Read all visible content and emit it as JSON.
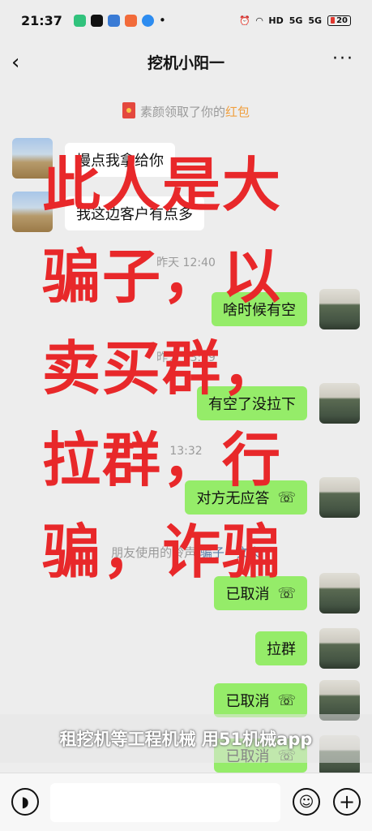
{
  "status_bar": {
    "time": "21:37",
    "network_labels": [
      "HD",
      "5G",
      "5G"
    ],
    "battery": "20"
  },
  "header": {
    "back_icon": "chevron-left-icon",
    "title": "挖机小阳一",
    "more_icon": "more-dots-icon"
  },
  "system_notice": {
    "prefix": "素颜领取了你的",
    "highlight": "红包"
  },
  "messages": [
    {
      "side": "in",
      "text": "慢点我拿给你"
    },
    {
      "side": "in",
      "text": "我这边客户有点多"
    },
    {
      "side": "time",
      "text": "昨天 12:40"
    },
    {
      "side": "out",
      "text": "啥时候有空"
    },
    {
      "side": "time",
      "text": "昨天 13:39"
    },
    {
      "side": "out",
      "text": "有空了没拉下"
    },
    {
      "side": "time",
      "text": "13:32"
    },
    {
      "side": "out",
      "text": "对方无应答"
    },
    {
      "side": "ringtone",
      "prefix": "朋友使用的铃声 ",
      "link": "骗子 - 文夫"
    },
    {
      "side": "out",
      "text": "已取消"
    },
    {
      "side": "out",
      "text": "拉群"
    },
    {
      "side": "out",
      "text": "已取消"
    },
    {
      "side": "out",
      "text": "已取消"
    }
  ],
  "overlay_text": [
    "此人是大",
    "骗子，以",
    "卖买群，",
    "拉群，行",
    "骗，诈骗"
  ],
  "watermark": "租挖机等工程机械 用51机械app",
  "input_bar": {
    "voice_icon": "voice-icon",
    "emoji_icon": "emoji-icon",
    "plus_icon": "plus-icon"
  },
  "colors": {
    "outgoing_bubble": "#95ec69",
    "incoming_bubble": "#ffffff",
    "overlay_text": "#e8282a",
    "red_packet": "#f0a040"
  }
}
